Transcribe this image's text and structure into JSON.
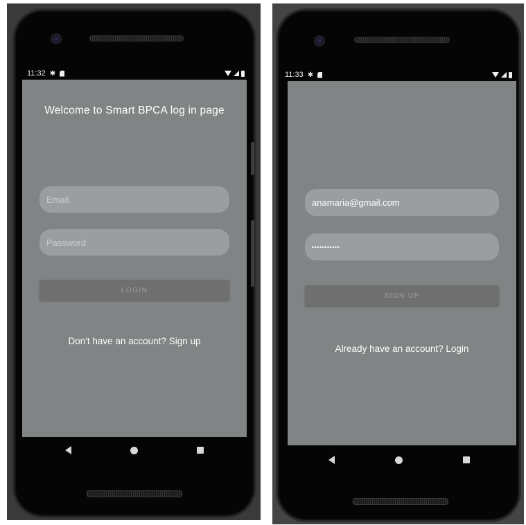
{
  "screen1": {
    "status_time": "11:32",
    "title": "Welcome to Smart BPCA log in page",
    "email_placeholder": "Email",
    "password_placeholder": "Password",
    "button_label": "LOGIN",
    "footer_link": "Don't have an account? Sign up"
  },
  "screen2": {
    "status_time": "11:33",
    "email_value": "anamaria@gmail.com",
    "password_value": "•••••••••••",
    "button_label": "SIGN UP",
    "footer_link": "Already have an account? Login"
  },
  "icons": {
    "settings": "gear-icon",
    "sd_card": "sd-card-icon",
    "wifi": "wifi-icon",
    "cell": "cell-signal-icon",
    "battery": "battery-icon",
    "back": "nav-back-icon",
    "home": "nav-home-icon",
    "recent": "nav-recent-icon"
  },
  "colors": {
    "screen_bg": "#808485",
    "field_bg": "#9a9ea0",
    "button_bg": "#6f6f70",
    "phone_body": "#050505"
  }
}
